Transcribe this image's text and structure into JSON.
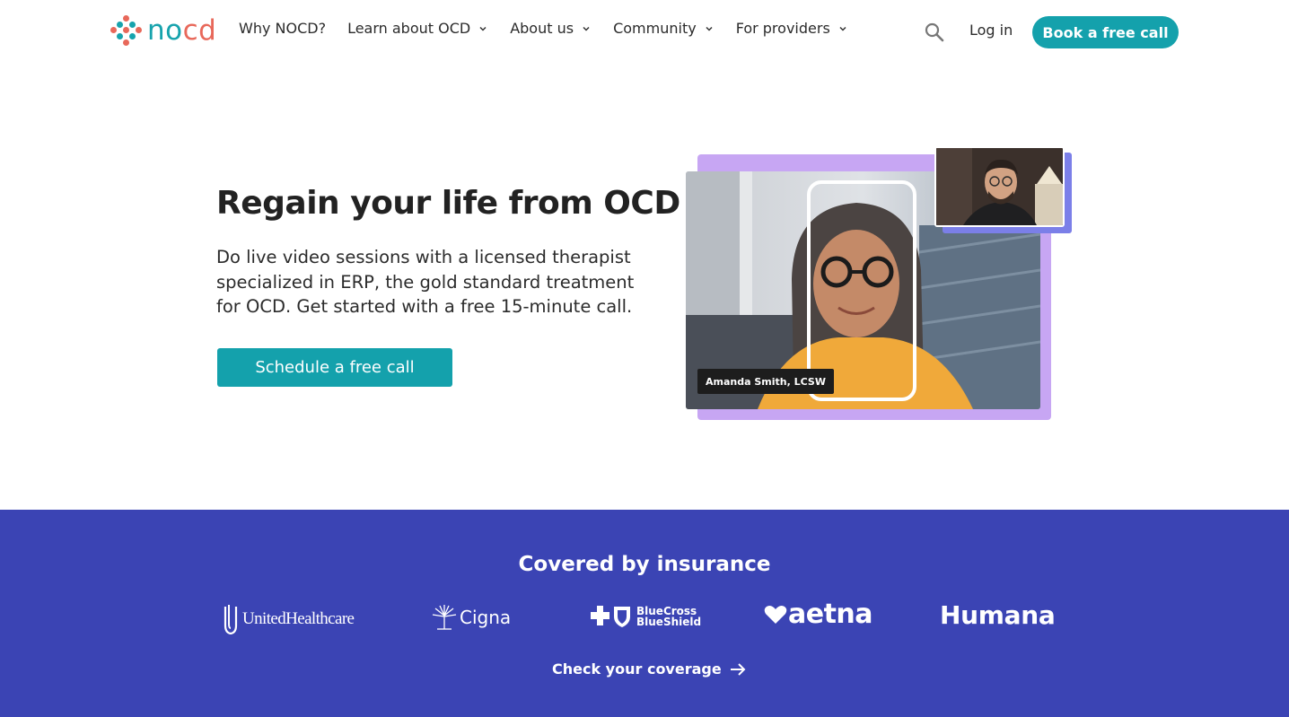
{
  "nav": {
    "logo_text": "nocd",
    "menu": [
      {
        "label": "Why NOCD?",
        "has_dropdown": false
      },
      {
        "label": "Learn about OCD",
        "has_dropdown": true
      },
      {
        "label": "About us",
        "has_dropdown": true
      },
      {
        "label": "Community",
        "has_dropdown": true
      },
      {
        "label": "For providers",
        "has_dropdown": true
      }
    ],
    "search_icon": "search-icon",
    "login_label": "Log in",
    "book_label": "Book a free call"
  },
  "hero": {
    "title": "Regain your life from OCD",
    "subtitle": "Do live video sessions with a licensed therapist specialized in ERP, the gold standard treatment for OCD. Get started with a free 15-minute call.",
    "cta_label": "Schedule a free call",
    "therapist_name": "Amanda Smith, LCSW"
  },
  "insurance": {
    "title": "Covered by insurance",
    "logos": [
      "UnitedHealthcare",
      "Cigna",
      "BlueCross BlueShield",
      "aetna",
      "Humana"
    ],
    "bluecross_line1": "BlueCross",
    "bluecross_line2": "BlueShield",
    "coverage_label": "Check your coverage"
  },
  "colors": {
    "teal": "#14a1ac",
    "coral": "#e8685a",
    "insurance_bg": "#3b44b4",
    "purple": "#c7a6f3",
    "periwinkle": "#7b7fe8"
  }
}
